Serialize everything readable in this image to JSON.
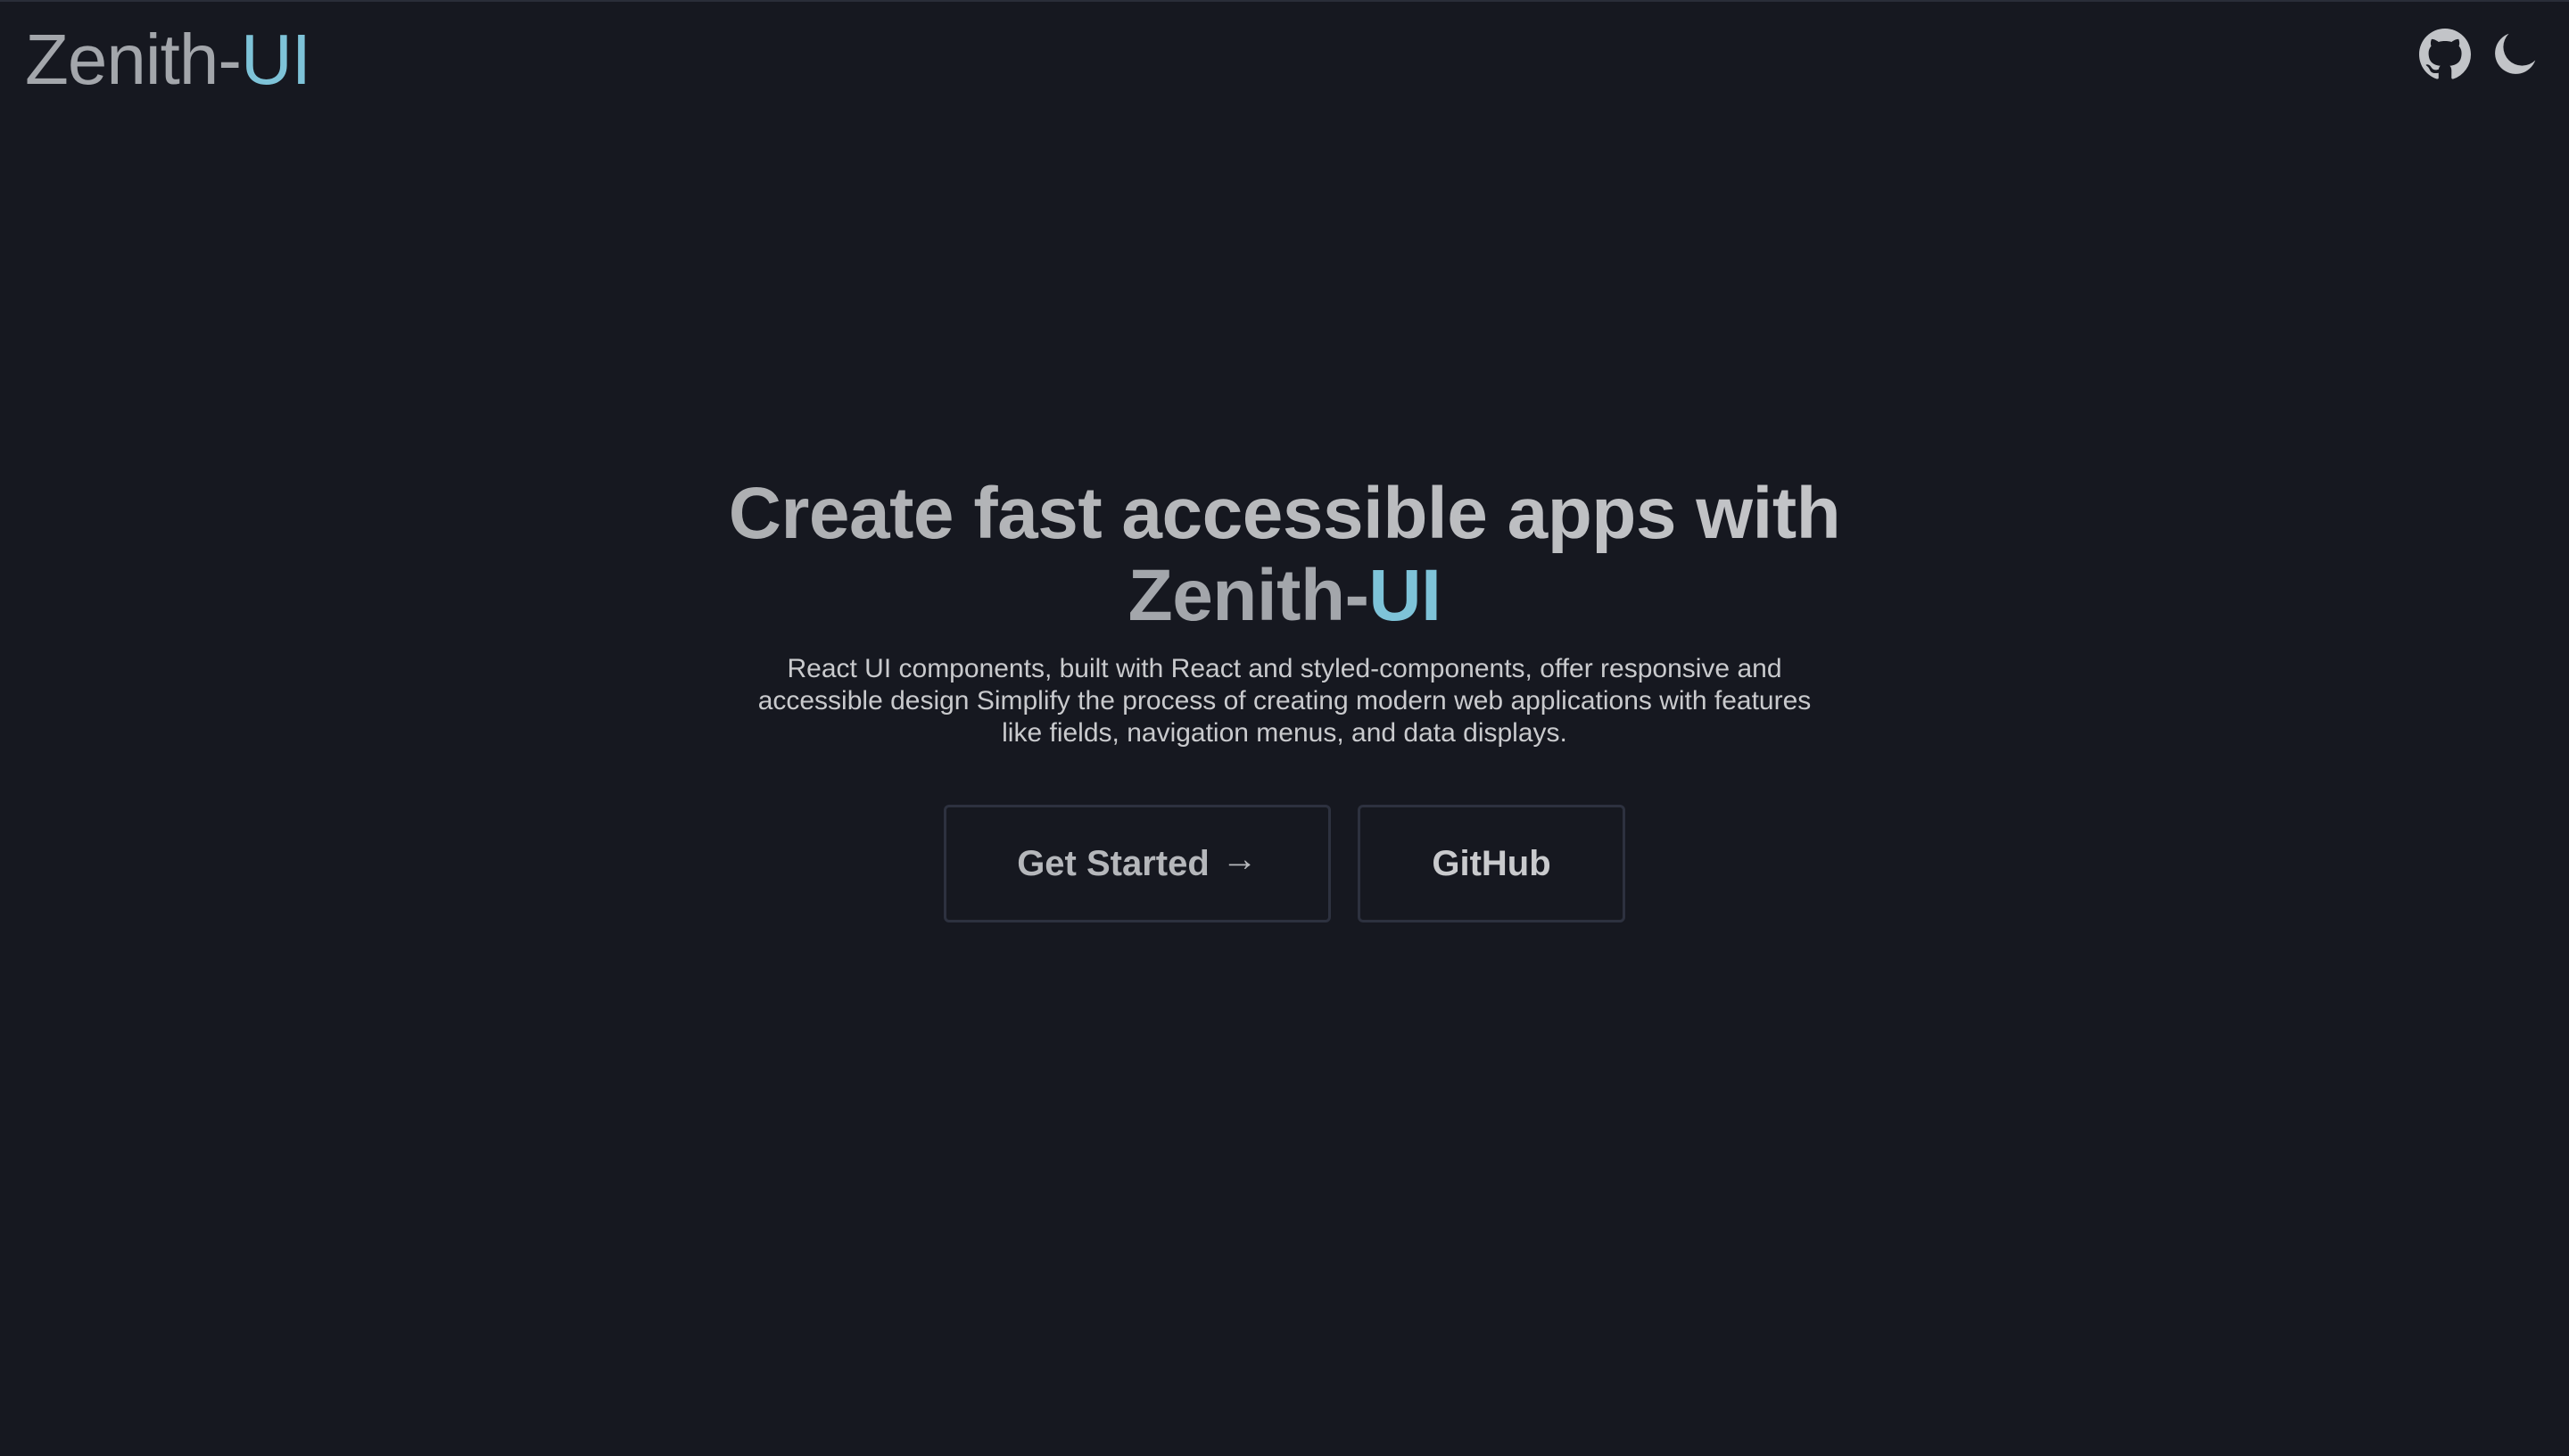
{
  "header": {
    "logo_part1": "Zenith-",
    "logo_part2": "UI",
    "icons": [
      "github-icon",
      "moon-icon"
    ]
  },
  "hero": {
    "title_line1": "Create fast accessible apps with",
    "brand_part1": "Zenith-",
    "brand_part2": "UI",
    "description": "React UI components, built with React and styled-components, offer responsive and accessible design Simplify the process of creating modern web applications with features like fields, navigation menus, and data displays."
  },
  "actions": {
    "get_started_label": "Get Started",
    "get_started_arrow": "→",
    "github_label": "GitHub"
  },
  "colors": {
    "background": "#161820",
    "accent": "#7ec3d8",
    "text_muted": "#a3a6ab"
  }
}
